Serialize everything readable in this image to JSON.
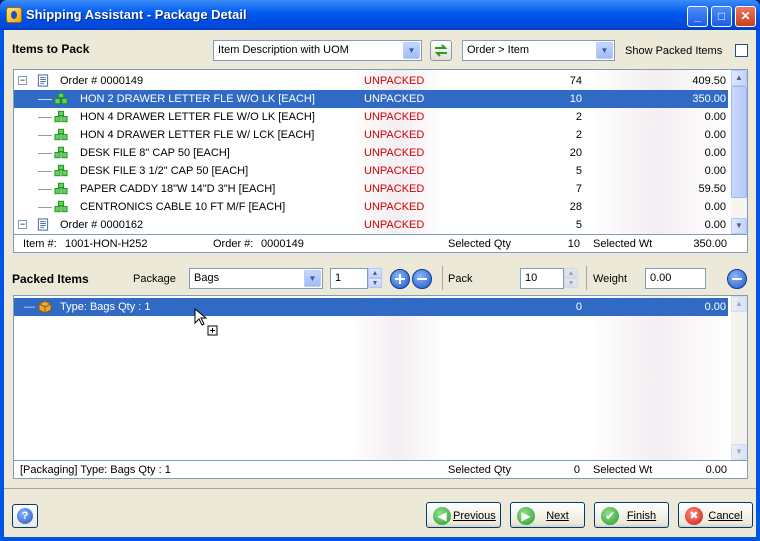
{
  "window": {
    "title": "Shipping Assistant - Package Detail"
  },
  "items_to_pack": {
    "label": "Items to Pack",
    "view_combo": "Item Description with UOM",
    "sort_combo": "Order > Item",
    "show_packed_label": "Show Packed Items",
    "rows": [
      {
        "kind": "order",
        "name": "Order # 0000149",
        "status": "UNPACKED",
        "qty": "74",
        "wt": "409.50",
        "selected": false
      },
      {
        "kind": "item",
        "name": "HON 2 DRAWER LETTER FLE W/O LK [EACH]",
        "status": "UNPACKED",
        "qty": "10",
        "wt": "350.00",
        "selected": true
      },
      {
        "kind": "item",
        "name": "HON 4 DRAWER LETTER FLE W/O LK [EACH]",
        "status": "UNPACKED",
        "qty": "2",
        "wt": "0.00",
        "selected": false
      },
      {
        "kind": "item",
        "name": "HON 4 DRAWER LETTER FLE W/ LCK [EACH]",
        "status": "UNPACKED",
        "qty": "2",
        "wt": "0.00",
        "selected": false
      },
      {
        "kind": "item",
        "name": "DESK FILE 8\" CAP 50 [EACH]",
        "status": "UNPACKED",
        "qty": "20",
        "wt": "0.00",
        "selected": false
      },
      {
        "kind": "item",
        "name": "DESK FILE 3 1/2\" CAP 50 [EACH]",
        "status": "UNPACKED",
        "qty": "5",
        "wt": "0.00",
        "selected": false
      },
      {
        "kind": "item",
        "name": "PAPER CADDY 18\"W 14\"D 3\"H [EACH]",
        "status": "UNPACKED",
        "qty": "7",
        "wt": "59.50",
        "selected": false
      },
      {
        "kind": "item",
        "name": "CENTRONICS CABLE 10 FT M/F [EACH]",
        "status": "UNPACKED",
        "qty": "28",
        "wt": "0.00",
        "selected": false
      },
      {
        "kind": "order",
        "name": "Order # 0000162",
        "status": "UNPACKED",
        "qty": "5",
        "wt": "0.00",
        "selected": false
      }
    ],
    "status_bar": {
      "item_label": "Item #:",
      "item_value": "1001-HON-H252",
      "order_label": "Order #:",
      "order_value": "0000149",
      "sel_qty_label": "Selected Qty",
      "sel_qty_value": "10",
      "sel_wt_label": "Selected Wt",
      "sel_wt_value": "350.00"
    }
  },
  "packed_items": {
    "label": "Packed Items",
    "package_label": "Package",
    "package_combo": "Bags",
    "package_count": "1",
    "pack_label": "Pack",
    "pack_value": "10",
    "weight_label": "Weight",
    "weight_value": "0.00",
    "rows": [
      {
        "name": "Type:  Bags  Qty : 1",
        "qty": "0",
        "wt": "0.00",
        "selected": true
      }
    ],
    "status_bar": {
      "text": "[Packaging] Type:  Bags  Qty : 1",
      "sel_qty_label": "Selected Qty",
      "sel_qty_value": "0",
      "sel_wt_label": "Selected Wt",
      "sel_wt_value": "0.00"
    }
  },
  "buttons": {
    "previous": "Previous",
    "next": "Next",
    "finish": "Finish",
    "cancel": "Cancel"
  },
  "colors": {
    "status_unpacked": "#d40000",
    "selection": "#316ac5",
    "titlebar": "#0058ee"
  }
}
